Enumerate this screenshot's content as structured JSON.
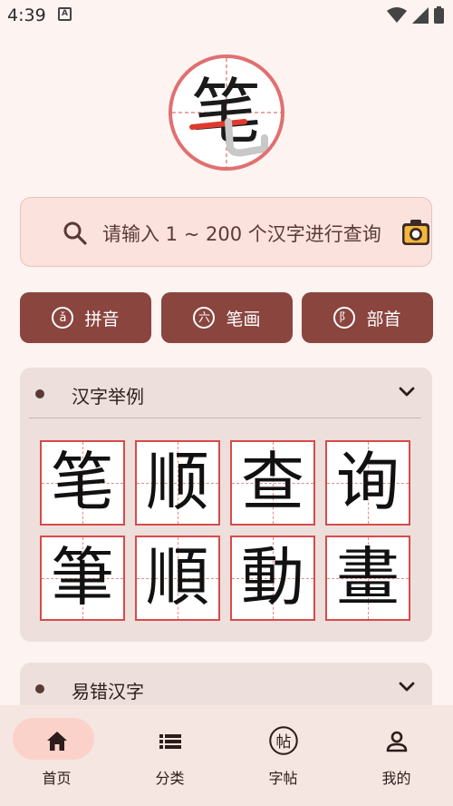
{
  "status_bar": {
    "time": "4:39",
    "notification_glyph": "A"
  },
  "logo": {
    "character": "笔"
  },
  "search": {
    "placeholder": "请输入 1 ~ 200 个汉字进行查询"
  },
  "categories": [
    {
      "icon_glyph": "ǎ",
      "label": "拼音"
    },
    {
      "icon_glyph": "六",
      "label": "笔画"
    },
    {
      "icon_glyph": "⻖",
      "label": "部首"
    }
  ],
  "examples": {
    "title": "汉字举例",
    "characters": [
      "笔",
      "顺",
      "查",
      "询",
      "筆",
      "順",
      "動",
      "畫"
    ]
  },
  "mistakes": {
    "title": "易错汉字"
  },
  "nav": [
    {
      "label": "首页",
      "icon": "home-icon",
      "active": true
    },
    {
      "label": "分类",
      "icon": "list-icon",
      "active": false
    },
    {
      "label": "字帖",
      "icon": "copybook-icon",
      "icon_glyph": "帖",
      "active": false
    },
    {
      "label": "我的",
      "icon": "profile-icon",
      "active": false
    }
  ],
  "colors": {
    "brand": "#8a453f",
    "accent_red": "#d84a4a",
    "background": "#fdf3f0"
  }
}
